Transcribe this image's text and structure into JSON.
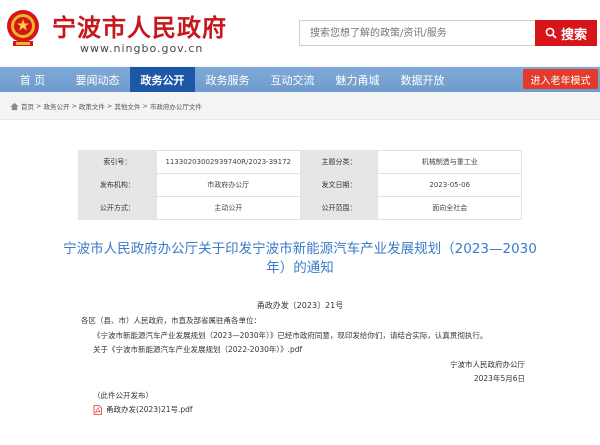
{
  "header": {
    "site_title": "宁波市人民政府",
    "site_url": "www.ningbo.gov.cn",
    "search_placeholder": "搜索您想了解的政策/资讯/服务",
    "search_button": "搜索"
  },
  "nav": {
    "items": [
      "首 页",
      "要闻动态",
      "政务公开",
      "政务服务",
      "互动交流",
      "魅力甬城",
      "数据开放"
    ],
    "active_index": 2,
    "elder_mode": "进入老年模式"
  },
  "breadcrumb": [
    "首页",
    "政务公开",
    "政策文件",
    "其他文件",
    "市政府办公厅文件"
  ],
  "meta": {
    "rows": [
      [
        {
          "k": "索引号：",
          "v": "11330203002939740R/2023-39172"
        },
        {
          "k": "主题分类：",
          "v": "机械制造与重工业"
        }
      ],
      [
        {
          "k": "发布机构：",
          "v": "市政府办公厅"
        },
        {
          "k": "发文日期：",
          "v": "2023-05-06"
        }
      ],
      [
        {
          "k": "公开方式：",
          "v": "主动公开"
        },
        {
          "k": "公开范围：",
          "v": "面向全社会"
        }
      ]
    ]
  },
  "document": {
    "title_line1": "宁波市人民政府办公厅关于印发宁波市新能源汽车产业发展规划（2023—2030",
    "title_line2": "年）的通知",
    "number": "甬政办发〔2023〕21号",
    "addressee": "各区（县、市）人民政府，市直及部省属驻甬各单位：",
    "body": "《宁波市新能源汽车产业发展规划（2023—2030年）》已经市政府同意，现印发给你们，请结合实际，认真贯彻执行。",
    "attachment_line": "关于《宁波市新能源汽车产业发展规划（2022-2030年）》.pdf",
    "sign_org": "宁波市人民政府办公厅",
    "sign_date": "2023年5月6日",
    "public_note": "（此件公开发布）",
    "attachment_file": "甬政办发(2023)21号.pdf"
  },
  "colors": {
    "brand_red": "#c8161d",
    "nav_blue": "#7fa9d7",
    "nav_active": "#1d57a7",
    "title_blue": "#3b7bc8"
  }
}
